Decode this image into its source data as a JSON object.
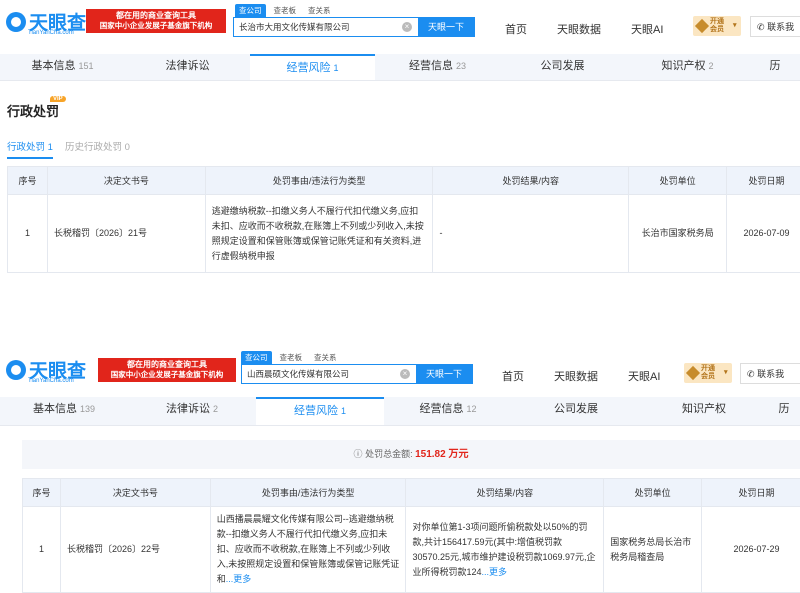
{
  "panel1": {
    "header": {
      "logo_text": "天眼查",
      "logo_sub": "TianYanCha.com",
      "slogan_line1": "都在用的商业查询工具",
      "slogan_line2": "国家中小企业发展子基金旗下机构",
      "search_value": "长治市大用文化传媒有限公司",
      "search_button": "天眼一下",
      "nav": [
        "首页",
        "天眼数据",
        "天眼AI"
      ],
      "vip_label": "开通会员",
      "contact": "联系我"
    },
    "tabs": [
      {
        "label": "基本信息",
        "count": "151"
      },
      {
        "label": "法律诉讼",
        "count": ""
      },
      {
        "label": "经营风险",
        "count": "1"
      },
      {
        "label": "经营信息",
        "count": "23"
      },
      {
        "label": "公司发展",
        "count": ""
      },
      {
        "label": "知识产权",
        "count": "2"
      },
      {
        "label": "历",
        "count": ""
      }
    ],
    "section_title": "行政处罚",
    "section_badge": "VIP",
    "subtabs": [
      {
        "label": "行政处罚",
        "count": "1"
      },
      {
        "label": "历史行政处罚",
        "count": "0"
      }
    ],
    "table": {
      "headers": [
        "序号",
        "决定文书号",
        "处罚事由/违法行为类型",
        "处罚结果/内容",
        "处罚单位",
        "处罚日期"
      ],
      "rows": [
        {
          "index": "1",
          "doc_no": "长税稽罚〔2026〕21号",
          "reason": "逃避缴纳税款--扣缴义务人不履行代扣代缴义务,应扣未扣、应收而不收税款,在账簿上不列或少列收入,未按照规定设置和保管账簿或保管记账凭证和有关资料,进行虚假纳税申报",
          "result": "-",
          "unit": "长治市国家税务局",
          "date": "2026-07-09"
        }
      ]
    }
  },
  "panel2": {
    "header": {
      "logo_text": "天眼查",
      "logo_sub": "TianYanCha.com",
      "slogan_line1": "都在用的商业查询工具",
      "slogan_line2": "国家中小企业发展子基金旗下机构",
      "qtabs": [
        "查公司",
        "查老板",
        "查关系"
      ],
      "search_value": "山西晨硕文化传媒有限公司",
      "search_button": "天眼一下",
      "nav": [
        "首页",
        "天眼数据",
        "天眼AI"
      ],
      "vip_label": "开通会员",
      "contact": "联系我"
    },
    "tabs": [
      {
        "label": "基本信息",
        "count": "139"
      },
      {
        "label": "法律诉讼",
        "count": "2"
      },
      {
        "label": "经营风险",
        "count": "1"
      },
      {
        "label": "经营信息",
        "count": "12"
      },
      {
        "label": "公司发展",
        "count": ""
      },
      {
        "label": "知识产权",
        "count": ""
      },
      {
        "label": "历",
        "count": ""
      }
    ],
    "summary_label": "处罚总金额:",
    "summary_value": "151.82 万元",
    "table": {
      "headers": [
        "序号",
        "决定文书号",
        "处罚事由/违法行为类型",
        "处罚结果/内容",
        "处罚单位",
        "处罚日期"
      ],
      "rows": [
        {
          "index": "1",
          "doc_no": "长税稽罚〔2026〕22号",
          "reason": "山西播晨晨耀文化传媒有限公司--逃避缴纳税款--扣缴义务人不履行代扣代缴义务,应扣未扣、应收而不收税款,在账簿上不列或少列收入,未按照规定设置和保管账簿或保管记账凭证和",
          "result": "对你单位第1-3项问题所偷税款处以50%的罚款,共计156417.59元(其中:增值税罚款30570.25元,城市维护建设税罚款1069.97元,企业所得税罚款124",
          "more": "...更多",
          "unit": "国家税务总局长治市税务局稽查局",
          "date": "2026-07-29"
        }
      ]
    }
  },
  "colors": {
    "accent": "#1b8df0",
    "brand_red": "#e1251b",
    "vip_gold": "#c78c2c"
  }
}
